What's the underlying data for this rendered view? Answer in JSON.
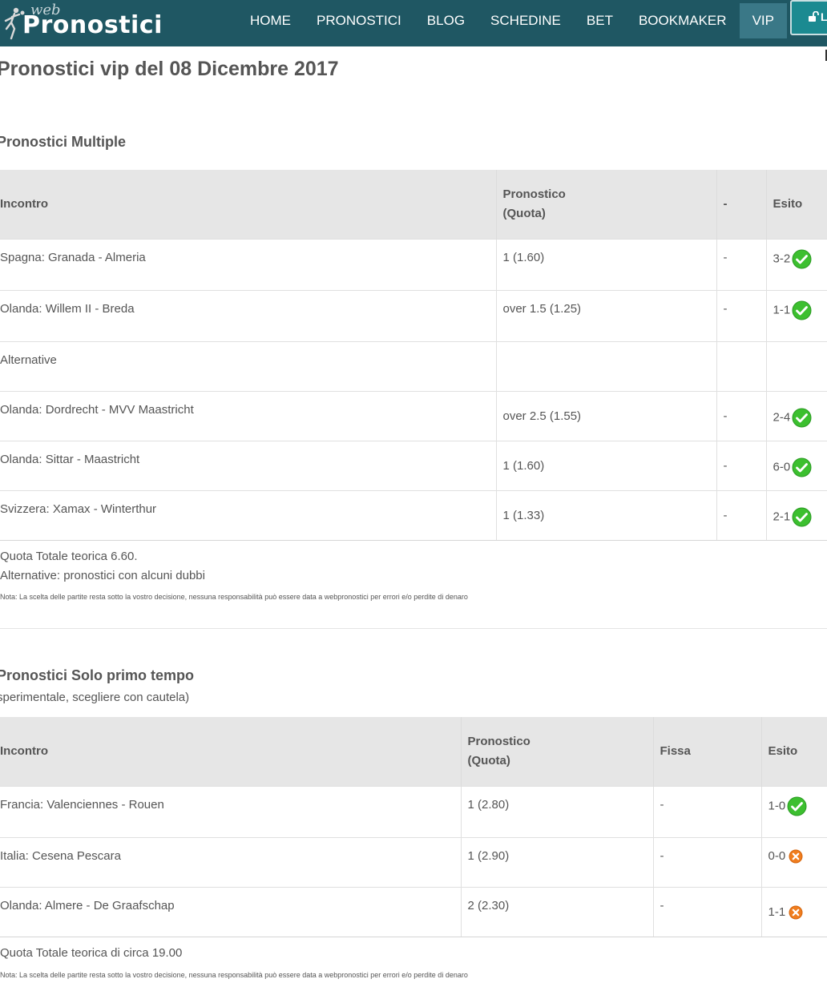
{
  "header": {
    "logo_top": "web",
    "logo_main": "Pronostici",
    "nav": [
      "HOME",
      "PRONOSTICI",
      "BLOG",
      "SCHEDINE",
      "BET",
      "BOOKMAKER",
      "VIP"
    ],
    "login_label": "L"
  },
  "page_title": "Pronostici vip del 08 Dicembre 2017",
  "multiple": {
    "title": "Pronostici Multiple",
    "headers": [
      "Incontro",
      "Pronostico (Quota)",
      "-",
      "Esito"
    ],
    "rows": [
      {
        "incontro": "Spagna: Granada - Almeria",
        "pronostico": "1 (1.60)",
        "extra": "-",
        "esito": "3-2",
        "status": "won"
      },
      {
        "incontro": "Olanda: Willem II - Breda",
        "pronostico": "over 1.5 (1.25)",
        "extra": "-",
        "esito": "1-1",
        "status": "won"
      },
      {
        "incontro": "Alternative",
        "pronostico": "",
        "extra": "",
        "esito": "",
        "status": ""
      },
      {
        "incontro": "Olanda: Dordrecht - MVV Maastricht",
        "pronostico": "over 2.5 (1.55)",
        "extra": "-",
        "esito": "2-4",
        "status": "won"
      },
      {
        "incontro": "Olanda: Sittar - Maastricht",
        "pronostico": "1 (1.60)",
        "extra": "-",
        "esito": "6-0",
        "status": "won"
      },
      {
        "incontro": "Svizzera: Xamax - Winterthur",
        "pronostico": "1 (1.33)",
        "extra": "-",
        "esito": "2-1",
        "status": "won"
      }
    ],
    "total": "Quota Totale teorica 6.60.",
    "alt_note": "Alternative: pronostici con alcuni dubbi",
    "disclaimer": "Nota: La scelta delle partite resta sotto la vostro decisione, nessuna responsabilità può essere data a webpronostici per errori e/o perdite di denaro"
  },
  "primo_tempo": {
    "title": "Pronostici Solo primo tempo",
    "subtitle": "sperimentale, scegliere con cautela)",
    "headers": [
      "Incontro",
      "Pronostico (Quota)",
      "Fissa",
      "Esito"
    ],
    "rows": [
      {
        "incontro": "Francia: Valenciennes - Rouen",
        "pronostico": "1 (2.80)",
        "extra": "-",
        "esito": "1-0",
        "status": "won"
      },
      {
        "incontro": "Italia: Cesena Pescara",
        "pronostico": "1 (2.90)",
        "extra": "-",
        "esito": "0-0",
        "status": "lost"
      },
      {
        "incontro": "Olanda: Almere - De Graafschap",
        "pronostico": "2 (2.30)",
        "extra": "-",
        "esito": "1-1",
        "status": "lost"
      }
    ],
    "total": "Quota Totale teorica di circa 19.00",
    "disclaimer": "Nota: La scelta delle partite resta sotto la vostro decisione, nessuna responsabilità può essere data a webpronostici per errori e/o perdite di denaro"
  },
  "colors": {
    "nav_bg": "#1f5763",
    "nav_active": "#3a7887",
    "win": "#3cbf2f",
    "loss": "#f07d1e"
  }
}
